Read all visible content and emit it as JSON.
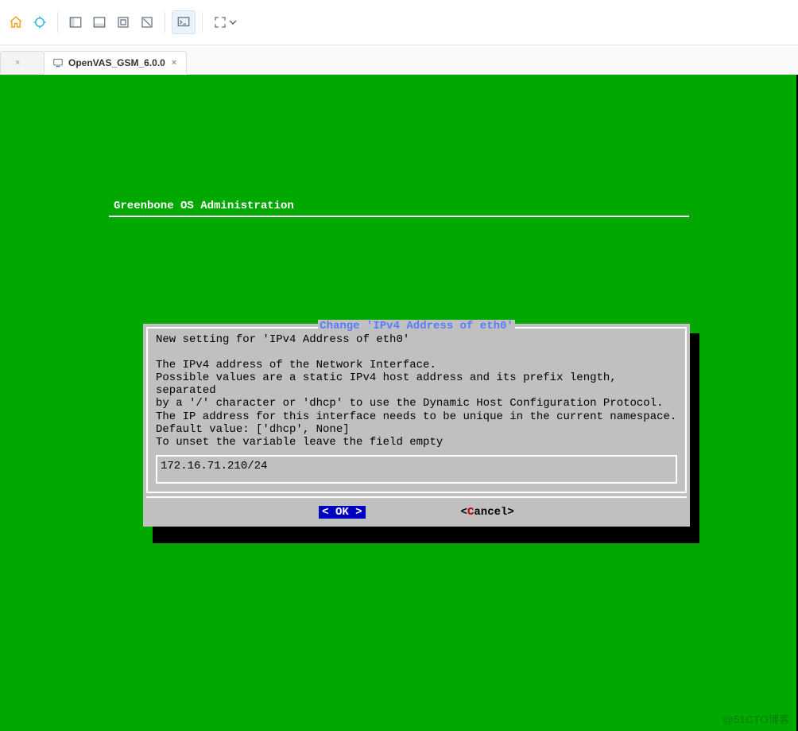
{
  "toolbar": {
    "icons": [
      "home-icon",
      "pin-icon",
      "pane-left-icon",
      "pane-bottom-icon",
      "fit-screen-icon",
      "disconnect-icon",
      "console-icon",
      "fullscreen-icon"
    ]
  },
  "tabs": {
    "items": [
      {
        "label": ""
      },
      {
        "label": "OpenVAS_GSM_6.0.0"
      }
    ]
  },
  "console": {
    "admin_title": "Greenbone OS Administration"
  },
  "dialog": {
    "caption": "Change 'IPv4 Address of eth0'",
    "lines": [
      "New setting for 'IPv4 Address of eth0'",
      "",
      "The IPv4 address of the Network Interface.",
      "Possible values are a static IPv4 host address and its prefix length, separated",
      "by a '/' character or 'dhcp' to use the Dynamic Host Configuration Protocol.",
      "The IP address for this interface needs to be unique in the current namespace.",
      "Default value: ['dhcp', None]",
      "To unset the variable leave the field empty"
    ],
    "input_value": "172.16.71.210/24",
    "ok_label": "OK",
    "cancel_label": "Cancel",
    "cancel_hotkey": "C"
  },
  "watermark": "@51CTO博客"
}
